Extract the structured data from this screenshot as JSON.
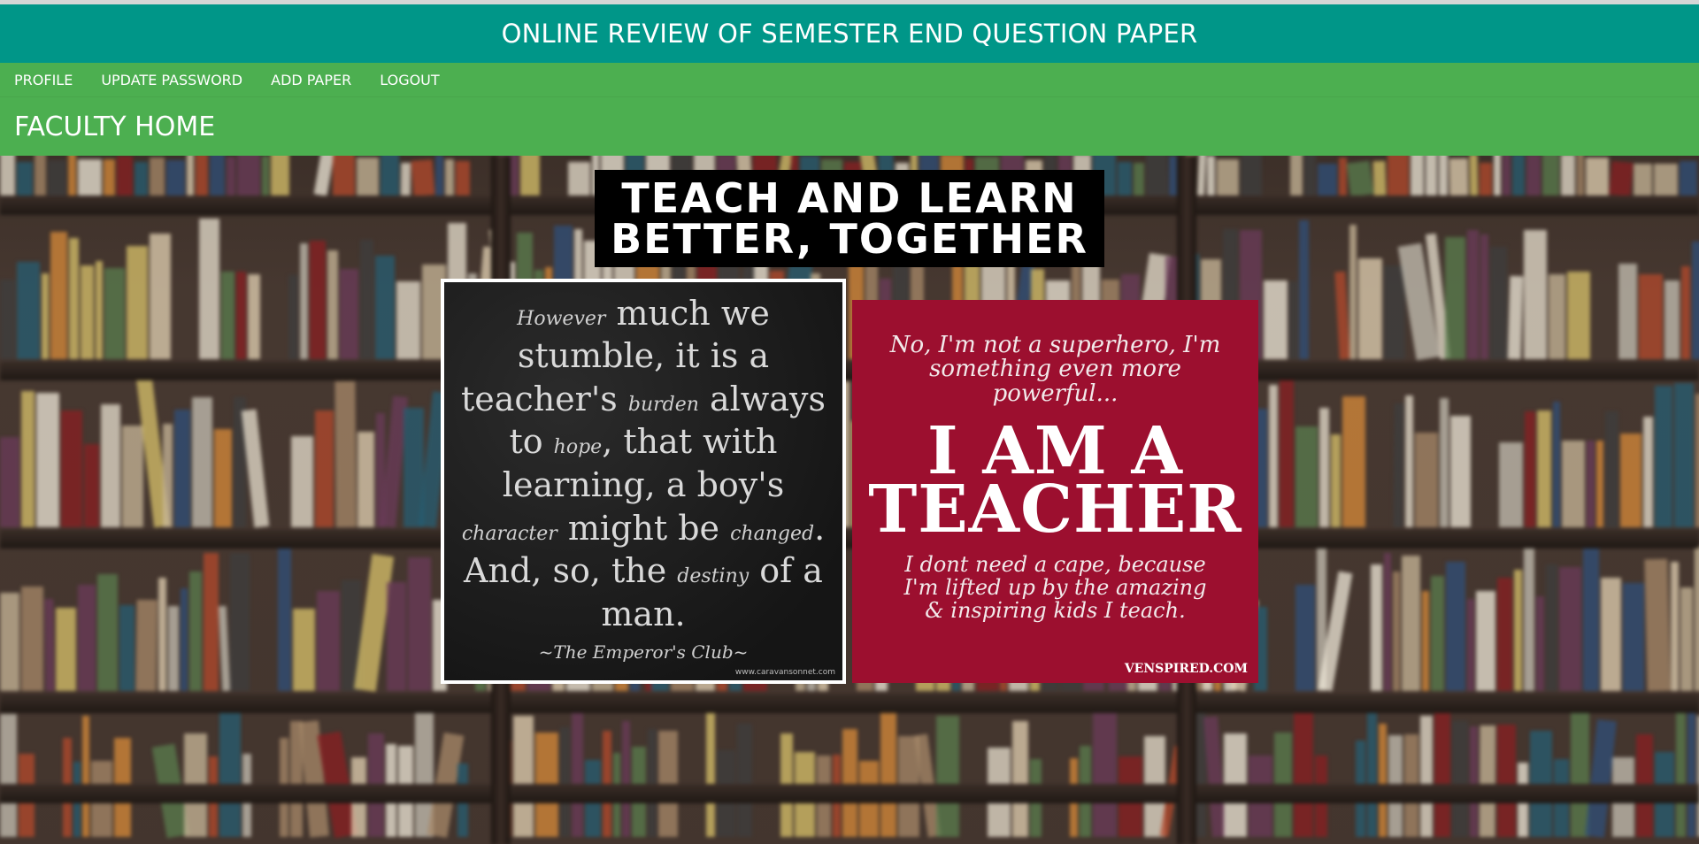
{
  "app": {
    "title": "ONLINE REVIEW OF SEMESTER END QUESTION PAPER"
  },
  "nav": {
    "items": [
      {
        "label": "PROFILE"
      },
      {
        "label": "UPDATE PASSWORD"
      },
      {
        "label": "ADD PAPER"
      },
      {
        "label": "LOGOUT"
      }
    ]
  },
  "page": {
    "heading": "FACULTY HOME"
  },
  "banner": {
    "line1": "TEACH AND LEARN",
    "line2": "BETTER, TOGETHER"
  },
  "quote_card": {
    "text_html_parts": [
      "However",
      " much we stumble, it is a teacher's ",
      "burden",
      " always to ",
      "hope",
      ", that with learning, a boy's ",
      "character",
      " might be ",
      "changed",
      ". And, so, the ",
      "destiny",
      " of a man."
    ],
    "source": "~The Emperor's Club~",
    "credit": "www.caravansonnet.com"
  },
  "teacher_card": {
    "intro": "No, I'm not a superhero, I'm something even more powerful...",
    "big_line1": "I AM A",
    "big_line2": "TEACHER",
    "outro": "I dont need a cape, because I'm lifted up by the amazing & inspiring kids I teach.",
    "credit": "VENSPIRED.COM"
  },
  "colors": {
    "title_bar": "#009688",
    "nav_bar": "#4caf50",
    "teacher_card_bg": "#9c0f2f"
  }
}
